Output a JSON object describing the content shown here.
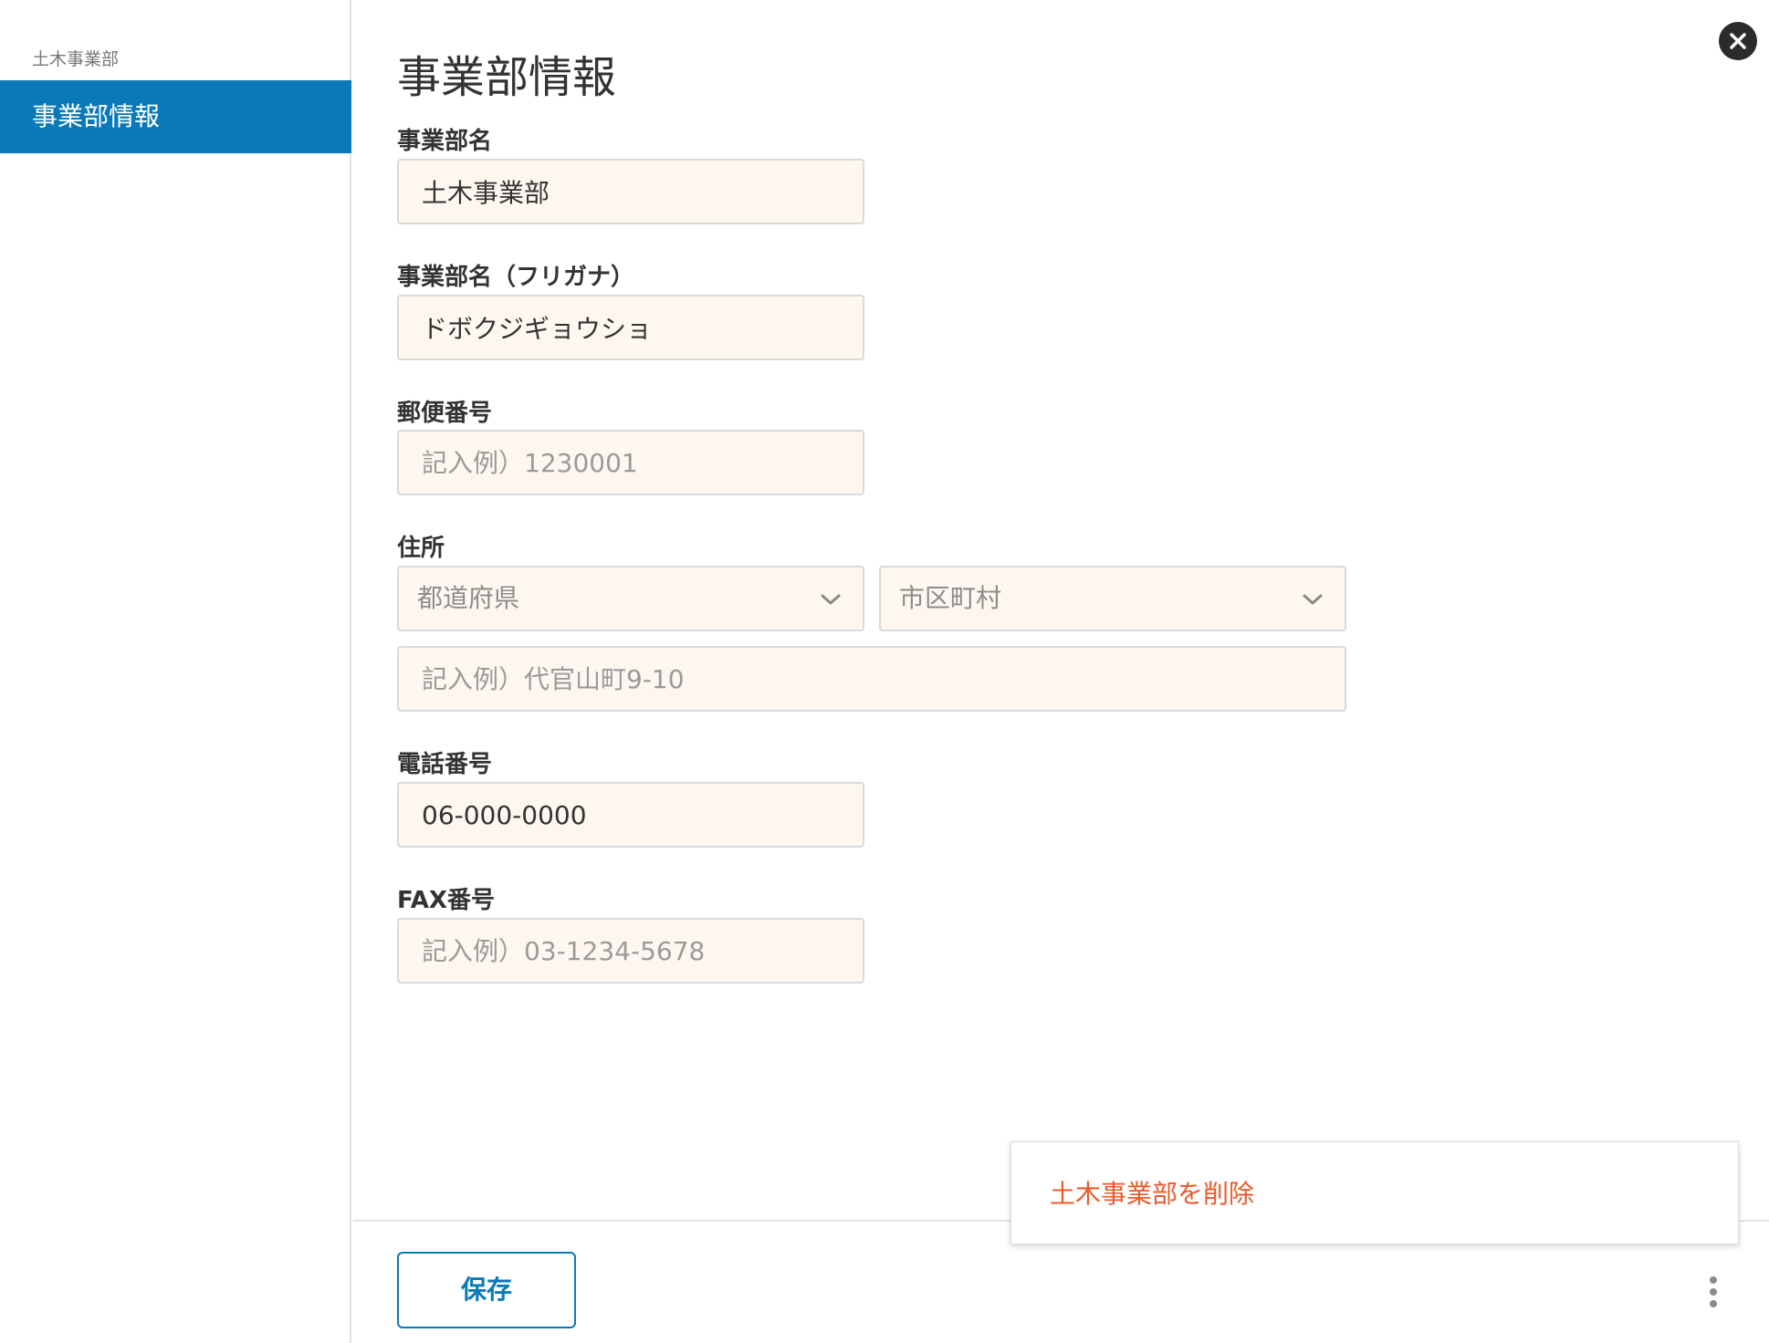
{
  "sidebar": {
    "group_label": "土木事業部",
    "items": [
      {
        "label": "事業部情報",
        "active": true
      }
    ]
  },
  "page": {
    "title": "事業部情報"
  },
  "icons": {
    "close": "close-icon",
    "chevron": "chevron-down-icon",
    "more": "more-vertical-icon"
  },
  "colors": {
    "accent": "#0a79b7",
    "field_bg": "#fef7f0",
    "danger": "#ea5a2a"
  },
  "form": {
    "division_name": {
      "label": "事業部名",
      "value": "土木事業部",
      "placeholder": ""
    },
    "division_kana": {
      "label": "事業部名（フリガナ）",
      "value": "ドボクジギョウショ",
      "placeholder": ""
    },
    "postal_code": {
      "label": "郵便番号",
      "value": "",
      "placeholder": "記入例）1230001"
    },
    "address": {
      "label": "住所",
      "prefecture": {
        "placeholder": "都道府県"
      },
      "city": {
        "placeholder": "市区町村"
      },
      "street": {
        "value": "",
        "placeholder": "記入例）代官山町9-10"
      }
    },
    "phone": {
      "label": "電話番号",
      "value": "06-000-0000",
      "placeholder": ""
    },
    "fax": {
      "label": "FAX番号",
      "value": "",
      "placeholder": "記入例）03-1234-5678"
    }
  },
  "footer": {
    "save_label": "保存"
  },
  "menu": {
    "items": [
      {
        "label": "土木事業部を削除"
      }
    ]
  }
}
